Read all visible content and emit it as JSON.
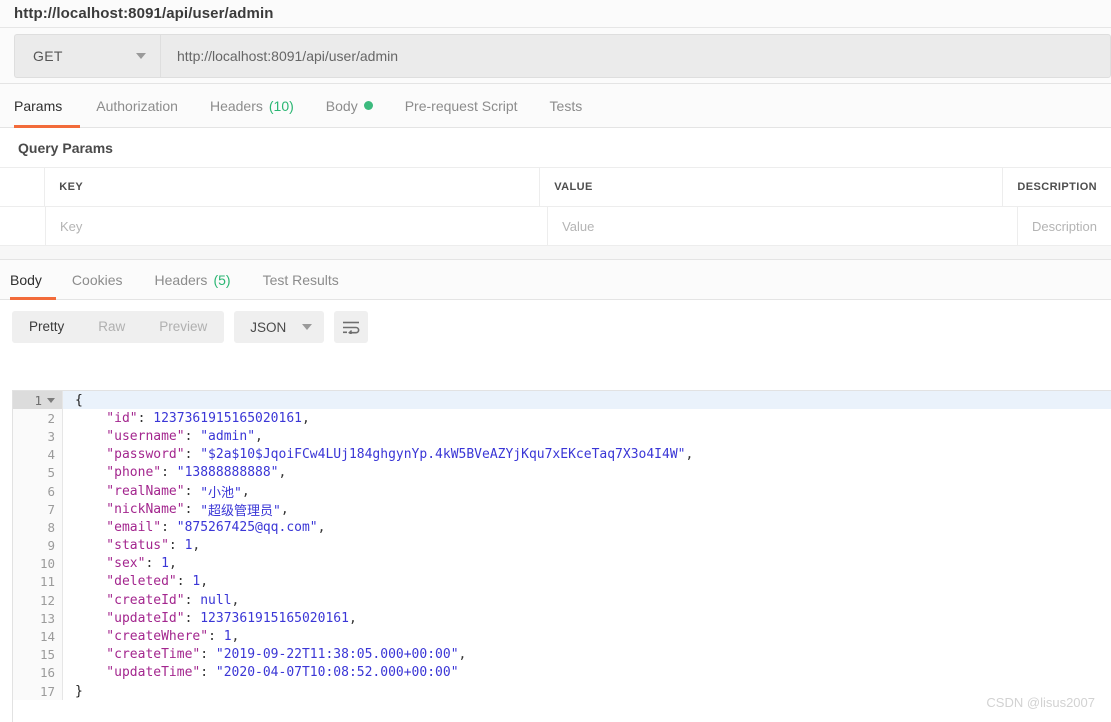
{
  "header": {
    "title": "http://localhost:8091/api/user/admin"
  },
  "request": {
    "method": "GET",
    "url": "http://localhost:8091/api/user/admin",
    "tabs": [
      {
        "label": "Params",
        "active": true
      },
      {
        "label": "Authorization",
        "active": false
      },
      {
        "label": "Headers",
        "count": "(10)",
        "active": false
      },
      {
        "label": "Body",
        "badge": "dot",
        "active": false
      },
      {
        "label": "Pre-request Script",
        "active": false
      },
      {
        "label": "Tests",
        "active": false
      }
    ]
  },
  "query_params": {
    "section_title": "Query Params",
    "columns": [
      "KEY",
      "VALUE",
      "DESCRIPTION"
    ],
    "placeholder_row": [
      "Key",
      "Value",
      "Description"
    ]
  },
  "response": {
    "tabs": [
      {
        "label": "Body",
        "active": true
      },
      {
        "label": "Cookies",
        "active": false
      },
      {
        "label": "Headers",
        "count": "(5)",
        "active": false
      },
      {
        "label": "Test Results",
        "active": false
      }
    ],
    "format_options": [
      "Pretty",
      "Raw",
      "Preview"
    ],
    "format_active": "Pretty",
    "language": "JSON",
    "wrap_icon": "word-wrap-icon"
  },
  "code": {
    "lines": [
      {
        "n": "1",
        "tokens": [
          {
            "t": "{",
            "c": "k-brace"
          }
        ]
      },
      {
        "n": "2",
        "tokens": [
          {
            "t": "    \"id\"",
            "c": "k-key"
          },
          {
            "t": ": ",
            "c": "k-pun"
          },
          {
            "t": "1237361915165020161",
            "c": "k-num"
          },
          {
            "t": ",",
            "c": "k-pun"
          }
        ]
      },
      {
        "n": "3",
        "tokens": [
          {
            "t": "    \"username\"",
            "c": "k-key"
          },
          {
            "t": ": ",
            "c": "k-pun"
          },
          {
            "t": "\"admin\"",
            "c": "k-str"
          },
          {
            "t": ",",
            "c": "k-pun"
          }
        ]
      },
      {
        "n": "4",
        "tokens": [
          {
            "t": "    \"password\"",
            "c": "k-key"
          },
          {
            "t": ": ",
            "c": "k-pun"
          },
          {
            "t": "\"$2a$10$JqoiFCw4LUj184ghgynYp.4kW5BVeAZYjKqu7xEKceTaq7X3o4I4W\"",
            "c": "k-str"
          },
          {
            "t": ",",
            "c": "k-pun"
          }
        ]
      },
      {
        "n": "5",
        "tokens": [
          {
            "t": "    \"phone\"",
            "c": "k-key"
          },
          {
            "t": ": ",
            "c": "k-pun"
          },
          {
            "t": "\"13888888888\"",
            "c": "k-str"
          },
          {
            "t": ",",
            "c": "k-pun"
          }
        ]
      },
      {
        "n": "6",
        "tokens": [
          {
            "t": "    \"realName\"",
            "c": "k-key"
          },
          {
            "t": ": ",
            "c": "k-pun"
          },
          {
            "t": "\"小池\"",
            "c": "k-str"
          },
          {
            "t": ",",
            "c": "k-pun"
          }
        ]
      },
      {
        "n": "7",
        "tokens": [
          {
            "t": "    \"nickName\"",
            "c": "k-key"
          },
          {
            "t": ": ",
            "c": "k-pun"
          },
          {
            "t": "\"超级管理员\"",
            "c": "k-str"
          },
          {
            "t": ",",
            "c": "k-pun"
          }
        ]
      },
      {
        "n": "8",
        "tokens": [
          {
            "t": "    \"email\"",
            "c": "k-key"
          },
          {
            "t": ": ",
            "c": "k-pun"
          },
          {
            "t": "\"875267425@qq.com\"",
            "c": "k-str"
          },
          {
            "t": ",",
            "c": "k-pun"
          }
        ]
      },
      {
        "n": "9",
        "tokens": [
          {
            "t": "    \"status\"",
            "c": "k-key"
          },
          {
            "t": ": ",
            "c": "k-pun"
          },
          {
            "t": "1",
            "c": "k-num"
          },
          {
            "t": ",",
            "c": "k-pun"
          }
        ]
      },
      {
        "n": "10",
        "tokens": [
          {
            "t": "    \"sex\"",
            "c": "k-key"
          },
          {
            "t": ": ",
            "c": "k-pun"
          },
          {
            "t": "1",
            "c": "k-num"
          },
          {
            "t": ",",
            "c": "k-pun"
          }
        ]
      },
      {
        "n": "11",
        "tokens": [
          {
            "t": "    \"deleted\"",
            "c": "k-key"
          },
          {
            "t": ": ",
            "c": "k-pun"
          },
          {
            "t": "1",
            "c": "k-num"
          },
          {
            "t": ",",
            "c": "k-pun"
          }
        ]
      },
      {
        "n": "12",
        "tokens": [
          {
            "t": "    \"createId\"",
            "c": "k-key"
          },
          {
            "t": ": ",
            "c": "k-pun"
          },
          {
            "t": "null",
            "c": "k-null"
          },
          {
            "t": ",",
            "c": "k-pun"
          }
        ]
      },
      {
        "n": "13",
        "tokens": [
          {
            "t": "    \"updateId\"",
            "c": "k-key"
          },
          {
            "t": ": ",
            "c": "k-pun"
          },
          {
            "t": "1237361915165020161",
            "c": "k-num"
          },
          {
            "t": ",",
            "c": "k-pun"
          }
        ]
      },
      {
        "n": "14",
        "tokens": [
          {
            "t": "    \"createWhere\"",
            "c": "k-key"
          },
          {
            "t": ": ",
            "c": "k-pun"
          },
          {
            "t": "1",
            "c": "k-num"
          },
          {
            "t": ",",
            "c": "k-pun"
          }
        ]
      },
      {
        "n": "15",
        "tokens": [
          {
            "t": "    \"createTime\"",
            "c": "k-key"
          },
          {
            "t": ": ",
            "c": "k-pun"
          },
          {
            "t": "\"2019-09-22T11:38:05.000+00:00\"",
            "c": "k-str"
          },
          {
            "t": ",",
            "c": "k-pun"
          }
        ]
      },
      {
        "n": "16",
        "tokens": [
          {
            "t": "    \"updateTime\"",
            "c": "k-key"
          },
          {
            "t": ": ",
            "c": "k-pun"
          },
          {
            "t": "\"2020-04-07T10:08:52.000+00:00\"",
            "c": "k-str"
          }
        ]
      },
      {
        "n": "17",
        "tokens": [
          {
            "t": "}",
            "c": "k-brace"
          }
        ]
      }
    ]
  },
  "watermark": "CSDN @lisus2007",
  "colors": {
    "accent": "#f26b3a",
    "green": "#2bb673",
    "code_key": "#a3268e",
    "code_value": "#3a36d6"
  }
}
